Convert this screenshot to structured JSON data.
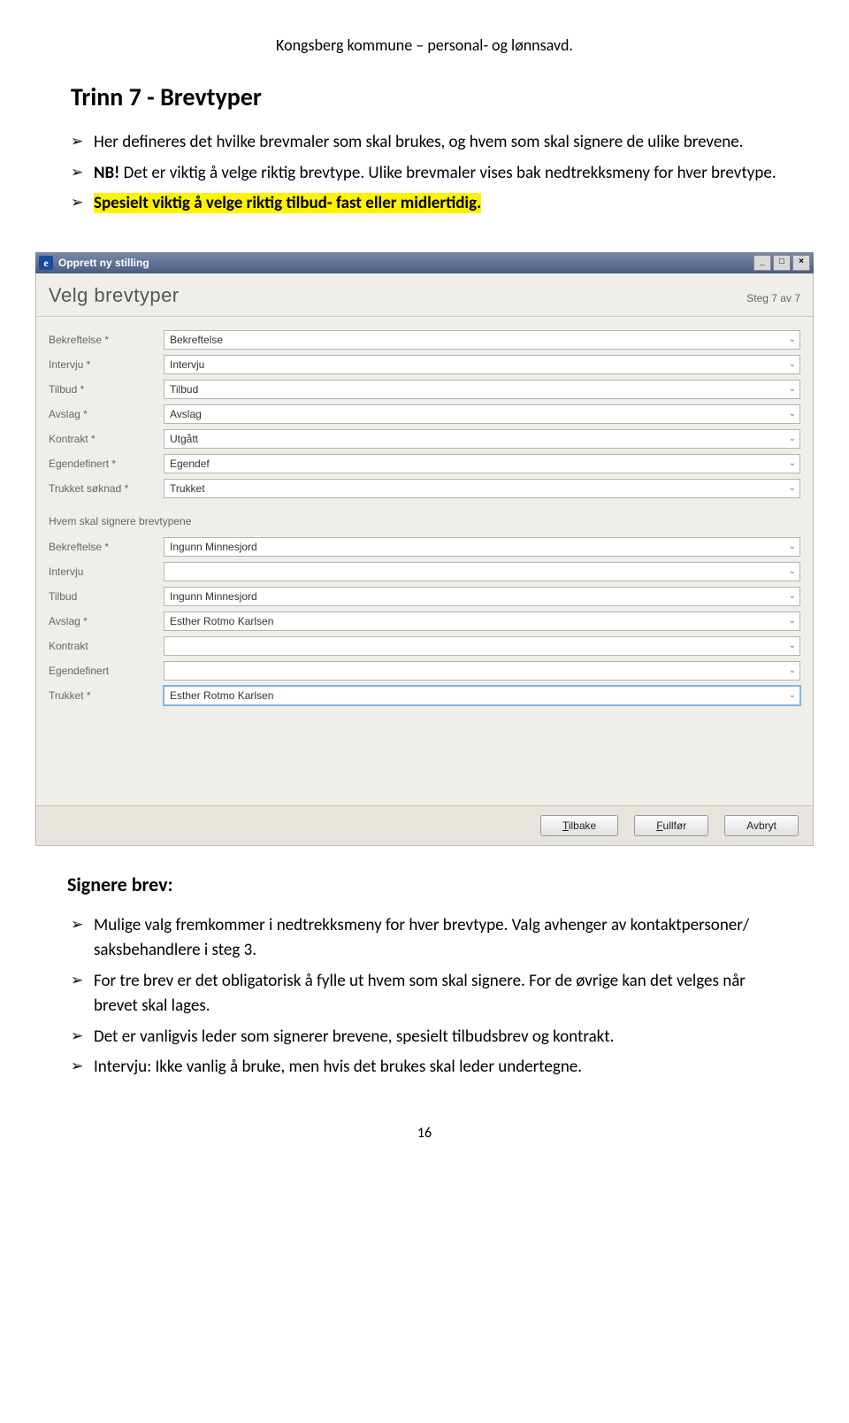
{
  "doc_header": "Kongsberg kommune – personal- og lønnsavd.",
  "heading": "Trinn 7 - Brevtyper",
  "intro_bullets": [
    "Her defineres det hvilke brevmaler som skal brukes, og hvem som skal signere de ulike brevene."
  ],
  "nb_label": "NB!",
  "nb_text": " Det er viktig å velge riktig brevtype. Ulike brevmaler vises bak nedtrekksmeny for hver brevtype.",
  "highlight_text": "Spesielt viktig å velge riktig tilbud- fast eller midlertidig.",
  "window": {
    "title": "Opprett ny stilling",
    "panel_title": "Velg brevtyper",
    "step_text": "Steg 7 av 7",
    "section1_rows": [
      {
        "label": "Bekreftelse *",
        "value": "Bekreftelse"
      },
      {
        "label": "Intervju *",
        "value": "Intervju"
      },
      {
        "label": "Tilbud *",
        "value": "Tilbud"
      },
      {
        "label": "Avslag *",
        "value": "Avslag"
      },
      {
        "label": "Kontrakt *",
        "value": "Utgått"
      },
      {
        "label": "Egendefinert *",
        "value": "Egendef"
      },
      {
        "label": "Trukket søknad *",
        "value": "Trukket"
      }
    ],
    "section2_title": "Hvem skal signere brevtypene",
    "section2_rows": [
      {
        "label": "Bekreftelse *",
        "value": "Ingunn Minnesjord"
      },
      {
        "label": "Intervju",
        "value": ""
      },
      {
        "label": "Tilbud",
        "value": "Ingunn Minnesjord"
      },
      {
        "label": "Avslag *",
        "value": "Esther Rotmo Karlsen"
      },
      {
        "label": "Kontrakt",
        "value": ""
      },
      {
        "label": "Egendefinert",
        "value": ""
      },
      {
        "label": "Trukket *",
        "value": "Esther Rotmo Karlsen"
      }
    ],
    "buttons": {
      "back": "Tilbake",
      "finish": "Fullfør",
      "cancel": "Avbryt"
    }
  },
  "sub_heading": "Signere brev:",
  "after_bullets": [
    "Mulige valg fremkommer i nedtrekksmeny for hver brevtype. Valg avhenger av kontaktpersoner/ saksbehandlere i steg 3.",
    "For tre brev er det obligatorisk å fylle ut hvem som skal signere. For de øvrige kan det velges når brevet skal lages.",
    "Det er vanligvis leder som signerer brevene, spesielt tilbudsbrev og kontrakt.",
    "Intervju: Ikke vanlig å bruke, men hvis det brukes skal leder undertegne."
  ],
  "page_number": "16"
}
